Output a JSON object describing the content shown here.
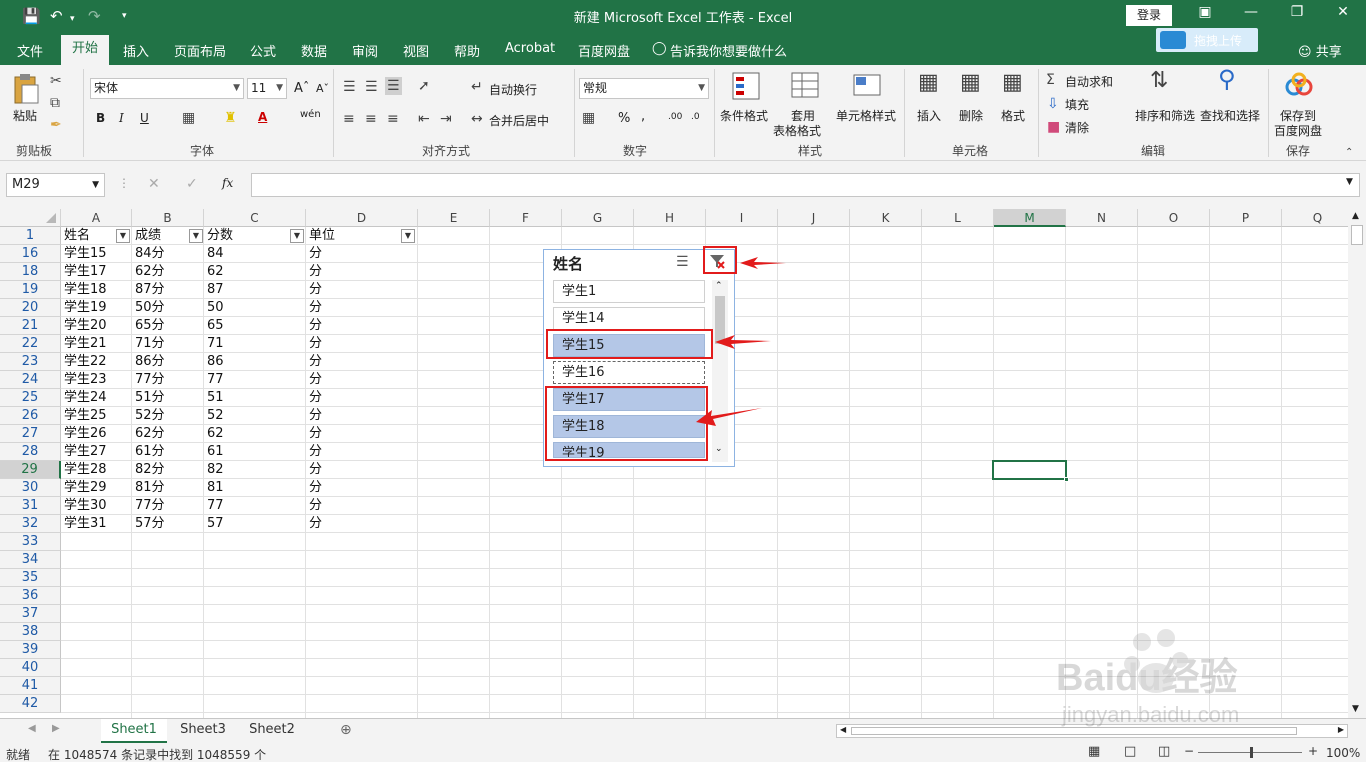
{
  "titlebar": {
    "title": "新建 Microsoft Excel 工作表  -  Excel",
    "login": "登录"
  },
  "menu": {
    "tabs": [
      "文件",
      "开始",
      "插入",
      "页面布局",
      "公式",
      "数据",
      "审阅",
      "视图",
      "帮助",
      "Acrobat",
      "百度网盘",
      "告诉我你想要做什么"
    ],
    "active_tab": "开始",
    "upload_button": "拖拽上传",
    "share": "共享"
  },
  "ribbon": {
    "clipboard": {
      "paste": "粘贴",
      "group": "剪贴板"
    },
    "font": {
      "name": "宋体",
      "size": "11",
      "group": "字体"
    },
    "alignment": {
      "wrap": "自动换行",
      "merge": "合并后居中",
      "group": "对齐方式"
    },
    "number": {
      "format": "常规",
      "group": "数字"
    },
    "styles": {
      "conditional": "条件格式",
      "table_1": "套用",
      "table_2": "表格格式",
      "cell_styles": "单元格样式",
      "group": "样式"
    },
    "cells": {
      "insert": "插入",
      "delete": "删除",
      "format": "格式",
      "group": "单元格"
    },
    "editing": {
      "autosum": "自动求和",
      "fill": "填充",
      "clear": "清除",
      "sort": "排序和筛选",
      "find": "查找和选择",
      "group": "编辑"
    },
    "save": {
      "line1": "保存到",
      "line2": "百度网盘",
      "group": "保存"
    }
  },
  "formula_bar": {
    "name_box": "M29",
    "fx": "fx",
    "value": ""
  },
  "columns": [
    "A",
    "B",
    "C",
    "D",
    "E",
    "F",
    "G",
    "H",
    "I",
    "J",
    "K",
    "L",
    "M",
    "N",
    "O",
    "P",
    "Q"
  ],
  "header_row": {
    "row": "1",
    "cells": [
      "姓名",
      "成绩",
      "分数",
      "单位"
    ]
  },
  "rows": [
    {
      "row": "16",
      "cells": [
        "学生15",
        "84分",
        "84",
        "分"
      ]
    },
    {
      "row": "18",
      "cells": [
        "学生17",
        "62分",
        "62",
        "分"
      ]
    },
    {
      "row": "19",
      "cells": [
        "学生18",
        "87分",
        "87",
        "分"
      ]
    },
    {
      "row": "20",
      "cells": [
        "学生19",
        "50分",
        "50",
        "分"
      ]
    },
    {
      "row": "21",
      "cells": [
        "学生20",
        "65分",
        "65",
        "分"
      ]
    },
    {
      "row": "22",
      "cells": [
        "学生21",
        "71分",
        "71",
        "分"
      ]
    },
    {
      "row": "23",
      "cells": [
        "学生22",
        "86分",
        "86",
        "分"
      ]
    },
    {
      "row": "24",
      "cells": [
        "学生23",
        "77分",
        "77",
        "分"
      ]
    },
    {
      "row": "25",
      "cells": [
        "学生24",
        "51分",
        "51",
        "分"
      ]
    },
    {
      "row": "26",
      "cells": [
        "学生25",
        "52分",
        "52",
        "分"
      ]
    },
    {
      "row": "27",
      "cells": [
        "学生26",
        "62分",
        "62",
        "分"
      ]
    },
    {
      "row": "28",
      "cells": [
        "学生27",
        "61分",
        "61",
        "分"
      ]
    },
    {
      "row": "29",
      "cells": [
        "学生28",
        "82分",
        "82",
        "分"
      ]
    },
    {
      "row": "30",
      "cells": [
        "学生29",
        "81分",
        "81",
        "分"
      ]
    },
    {
      "row": "31",
      "cells": [
        "学生30",
        "77分",
        "77",
        "分"
      ]
    },
    {
      "row": "32",
      "cells": [
        "学生31",
        "57分",
        "57",
        "分"
      ]
    },
    {
      "row": "33",
      "cells": [
        "",
        "",
        "",
        ""
      ]
    },
    {
      "row": "34",
      "cells": [
        "",
        "",
        "",
        ""
      ]
    },
    {
      "row": "35",
      "cells": [
        "",
        "",
        "",
        ""
      ]
    },
    {
      "row": "36",
      "cells": [
        "",
        "",
        "",
        ""
      ]
    },
    {
      "row": "37",
      "cells": [
        "",
        "",
        "",
        ""
      ]
    },
    {
      "row": "38",
      "cells": [
        "",
        "",
        "",
        ""
      ]
    },
    {
      "row": "39",
      "cells": [
        "",
        "",
        "",
        ""
      ]
    },
    {
      "row": "40",
      "cells": [
        "",
        "",
        "",
        ""
      ]
    },
    {
      "row": "41",
      "cells": [
        "",
        "",
        "",
        ""
      ]
    },
    {
      "row": "42",
      "cells": [
        "",
        "",
        "",
        ""
      ]
    }
  ],
  "slicer": {
    "title": "姓名",
    "items": [
      {
        "label": "学生1",
        "selected": false
      },
      {
        "label": "学生14",
        "selected": false
      },
      {
        "label": "学生15",
        "selected": true
      },
      {
        "label": "学生16",
        "selected": false
      },
      {
        "label": "学生17",
        "selected": true
      },
      {
        "label": "学生18",
        "selected": true
      },
      {
        "label": "学生19",
        "selected": true
      }
    ]
  },
  "sheets": {
    "tabs": [
      "Sheet1",
      "Sheet3",
      "Sheet2"
    ],
    "active": "Sheet1"
  },
  "status": {
    "mode": "就绪",
    "message": "在 1048574 条记录中找到 1048559 个",
    "zoom": "100%"
  },
  "watermark": {
    "brand": "Baidu经验",
    "url": "jingyan.baidu.com"
  },
  "colors": {
    "excel_green": "#217346",
    "selection_blue": "#b4c7e7",
    "annotation_red": "#e21b1b"
  }
}
